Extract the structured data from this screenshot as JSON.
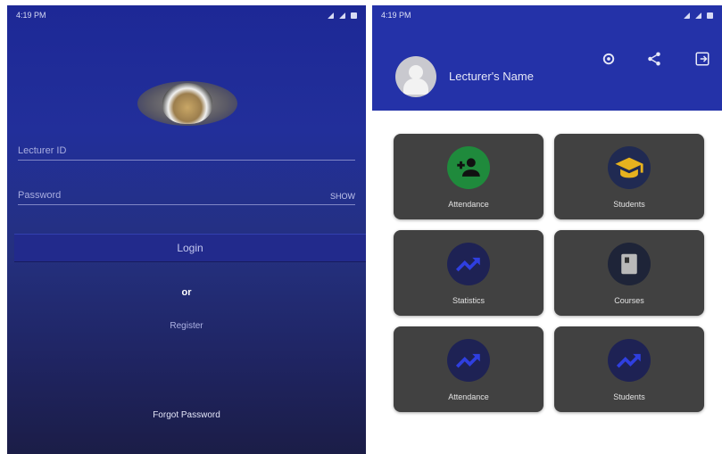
{
  "login_screen": {
    "status_bar": {
      "time": "4:19 PM",
      "indicator": "1"
    },
    "logo_icon": "university-crest-icon",
    "lecturer_id_placeholder": "Lecturer ID",
    "password_placeholder": "Password",
    "password_toggle_label": "SHOW",
    "login_button_label": "Login",
    "or_text": "or",
    "register_label": "Register",
    "forgot_password_label": "Forgot Password"
  },
  "dashboard_screen": {
    "status_bar": {
      "time": "4:19 PM"
    },
    "header": {
      "avatar_icon": "user-avatar-icon",
      "lecturer_name": "Lecturer's Name",
      "icons": [
        "settings-icon",
        "share-icon",
        "logout-icon"
      ]
    },
    "tiles": [
      {
        "label": "Attendance",
        "icon": "add-user-icon"
      },
      {
        "label": "Students",
        "icon": "graduation-cap-icon"
      },
      {
        "label": "Statistics",
        "icon": "trending-up-icon"
      },
      {
        "label": "Courses",
        "icon": "book-icon"
      },
      {
        "label": "Attendance",
        "icon": "trending-up-icon"
      },
      {
        "label": "Students",
        "icon": "trending-up-icon"
      }
    ]
  },
  "colors": {
    "login_gradient_top": "#1d2896",
    "login_gradient_bottom": "#1b1d47",
    "header_blue": "#2432a8",
    "tile_gray": "#414141",
    "attendance_green": "#1f8a3c",
    "cap_amber": "#e7b21e",
    "trend_blue": "#2f3fe0"
  }
}
